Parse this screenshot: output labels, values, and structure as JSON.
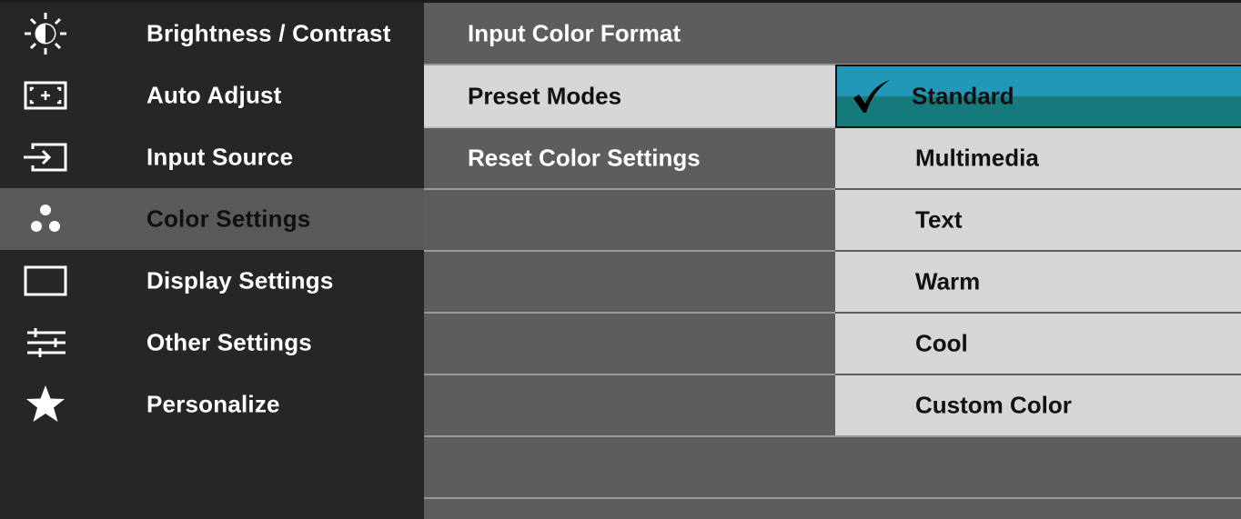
{
  "main_menu": {
    "items": [
      {
        "label": "Brightness / Contrast",
        "icon": "brightness-icon"
      },
      {
        "label": "Auto Adjust",
        "icon": "auto-adjust-icon"
      },
      {
        "label": "Input Source",
        "icon": "input-source-icon"
      },
      {
        "label": "Color Settings",
        "icon": "color-settings-icon",
        "selected": true
      },
      {
        "label": "Display Settings",
        "icon": "display-settings-icon"
      },
      {
        "label": "Other Settings",
        "icon": "other-settings-icon"
      },
      {
        "label": "Personalize",
        "icon": "star-icon"
      }
    ]
  },
  "submenu": {
    "items": [
      {
        "label": "Input Color Format"
      },
      {
        "label": "Preset Modes",
        "selected": true
      },
      {
        "label": "Reset Color Settings"
      }
    ]
  },
  "preset_modes": {
    "options": [
      {
        "label": "Standard",
        "checked": true
      },
      {
        "label": "Multimedia"
      },
      {
        "label": "Text"
      },
      {
        "label": "Warm"
      },
      {
        "label": "Cool"
      },
      {
        "label": "Custom Color"
      }
    ]
  },
  "colors": {
    "highlight_top": "#2297b8",
    "highlight_bottom": "#167a7a",
    "menu_bg": "#262626",
    "submenu_bg": "#5d5d5d",
    "selected_bg": "#d6d6d6"
  }
}
